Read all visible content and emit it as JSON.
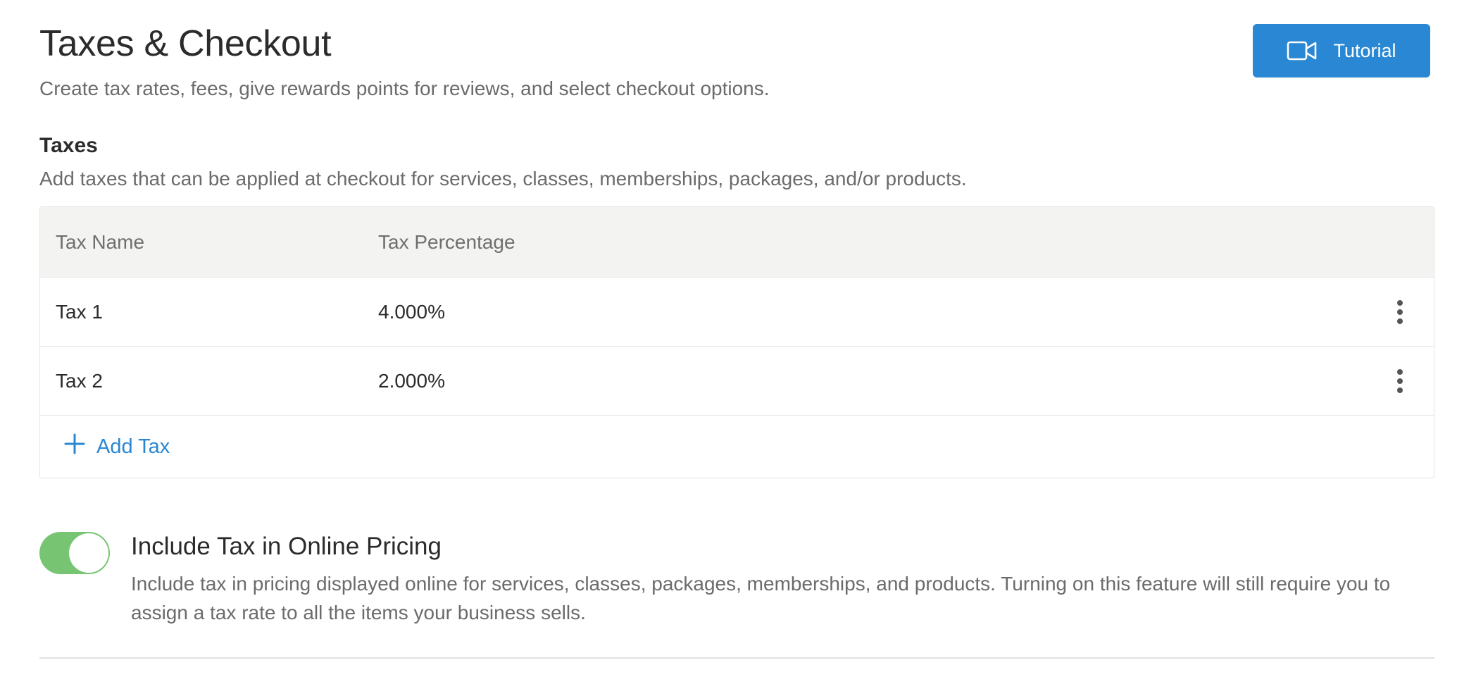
{
  "header": {
    "title": "Taxes & Checkout",
    "subtitle": "Create tax rates, fees, give rewards points for reviews, and select checkout options.",
    "tutorial_label": "Tutorial"
  },
  "taxes": {
    "title": "Taxes",
    "description": "Add taxes that can be applied at checkout for services, classes, memberships, packages, and/or products.",
    "columns": [
      "Tax Name",
      "Tax Percentage"
    ],
    "rows": [
      {
        "name": "Tax 1",
        "percentage": "4.000%"
      },
      {
        "name": "Tax 2",
        "percentage": "2.000%"
      }
    ],
    "add_label": "Add Tax"
  },
  "online_pricing": {
    "enabled": true,
    "title": "Include Tax in Online Pricing",
    "description": "Include tax in pricing displayed online for services, classes, packages, memberships, and products. Turning on this feature will still require you to assign a tax rate to all the items your business sells."
  },
  "colors": {
    "accent": "#2a87d3",
    "toggle_on": "#77c473",
    "header_bg": "#f3f3f2"
  },
  "icons": {
    "tutorial": "video-camera-icon",
    "row_menu": "more-vertical-icon",
    "add": "plus-icon"
  }
}
